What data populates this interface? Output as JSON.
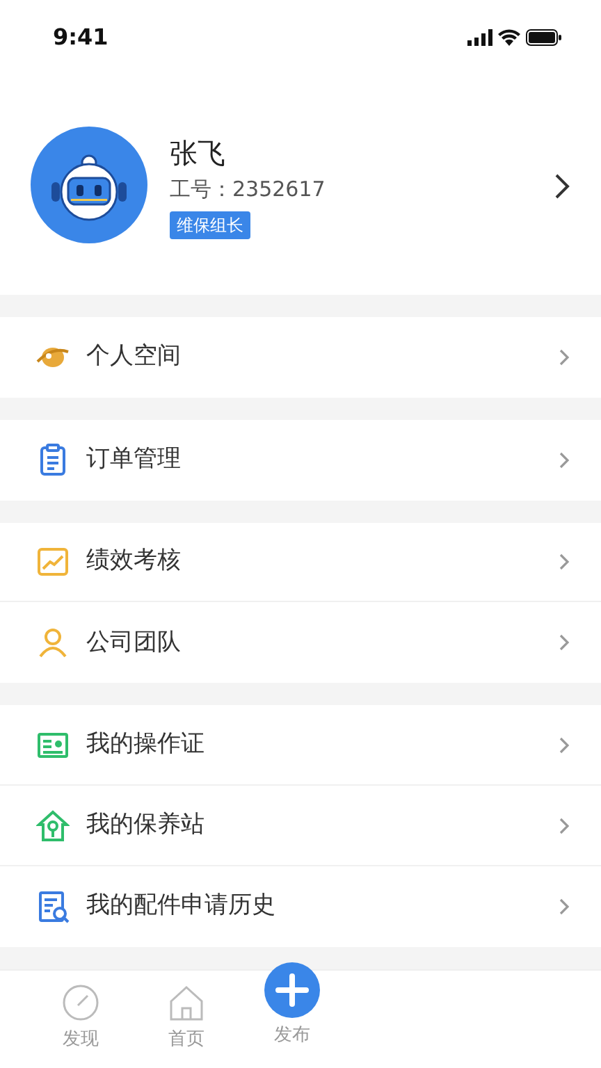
{
  "status_bar": {
    "time": "9:41"
  },
  "profile": {
    "name": "张飞",
    "employee_id": "工号：2352617",
    "role": "维保组长"
  },
  "groups": [
    [
      {
        "label": "个人空间"
      }
    ],
    [
      {
        "label": "订单管理"
      }
    ],
    [
      {
        "label": "绩效考核"
      },
      {
        "label": "公司团队"
      }
    ],
    [
      {
        "label": "我的操作证"
      },
      {
        "label": "我的保养站"
      },
      {
        "label": "我的配件申请历史"
      }
    ]
  ],
  "tab_bar": [
    {
      "label": "发现",
      "kind": "tab"
    },
    {
      "label": "首页",
      "kind": "tab"
    },
    {
      "label": "发布",
      "kind": "publish"
    }
  ]
}
